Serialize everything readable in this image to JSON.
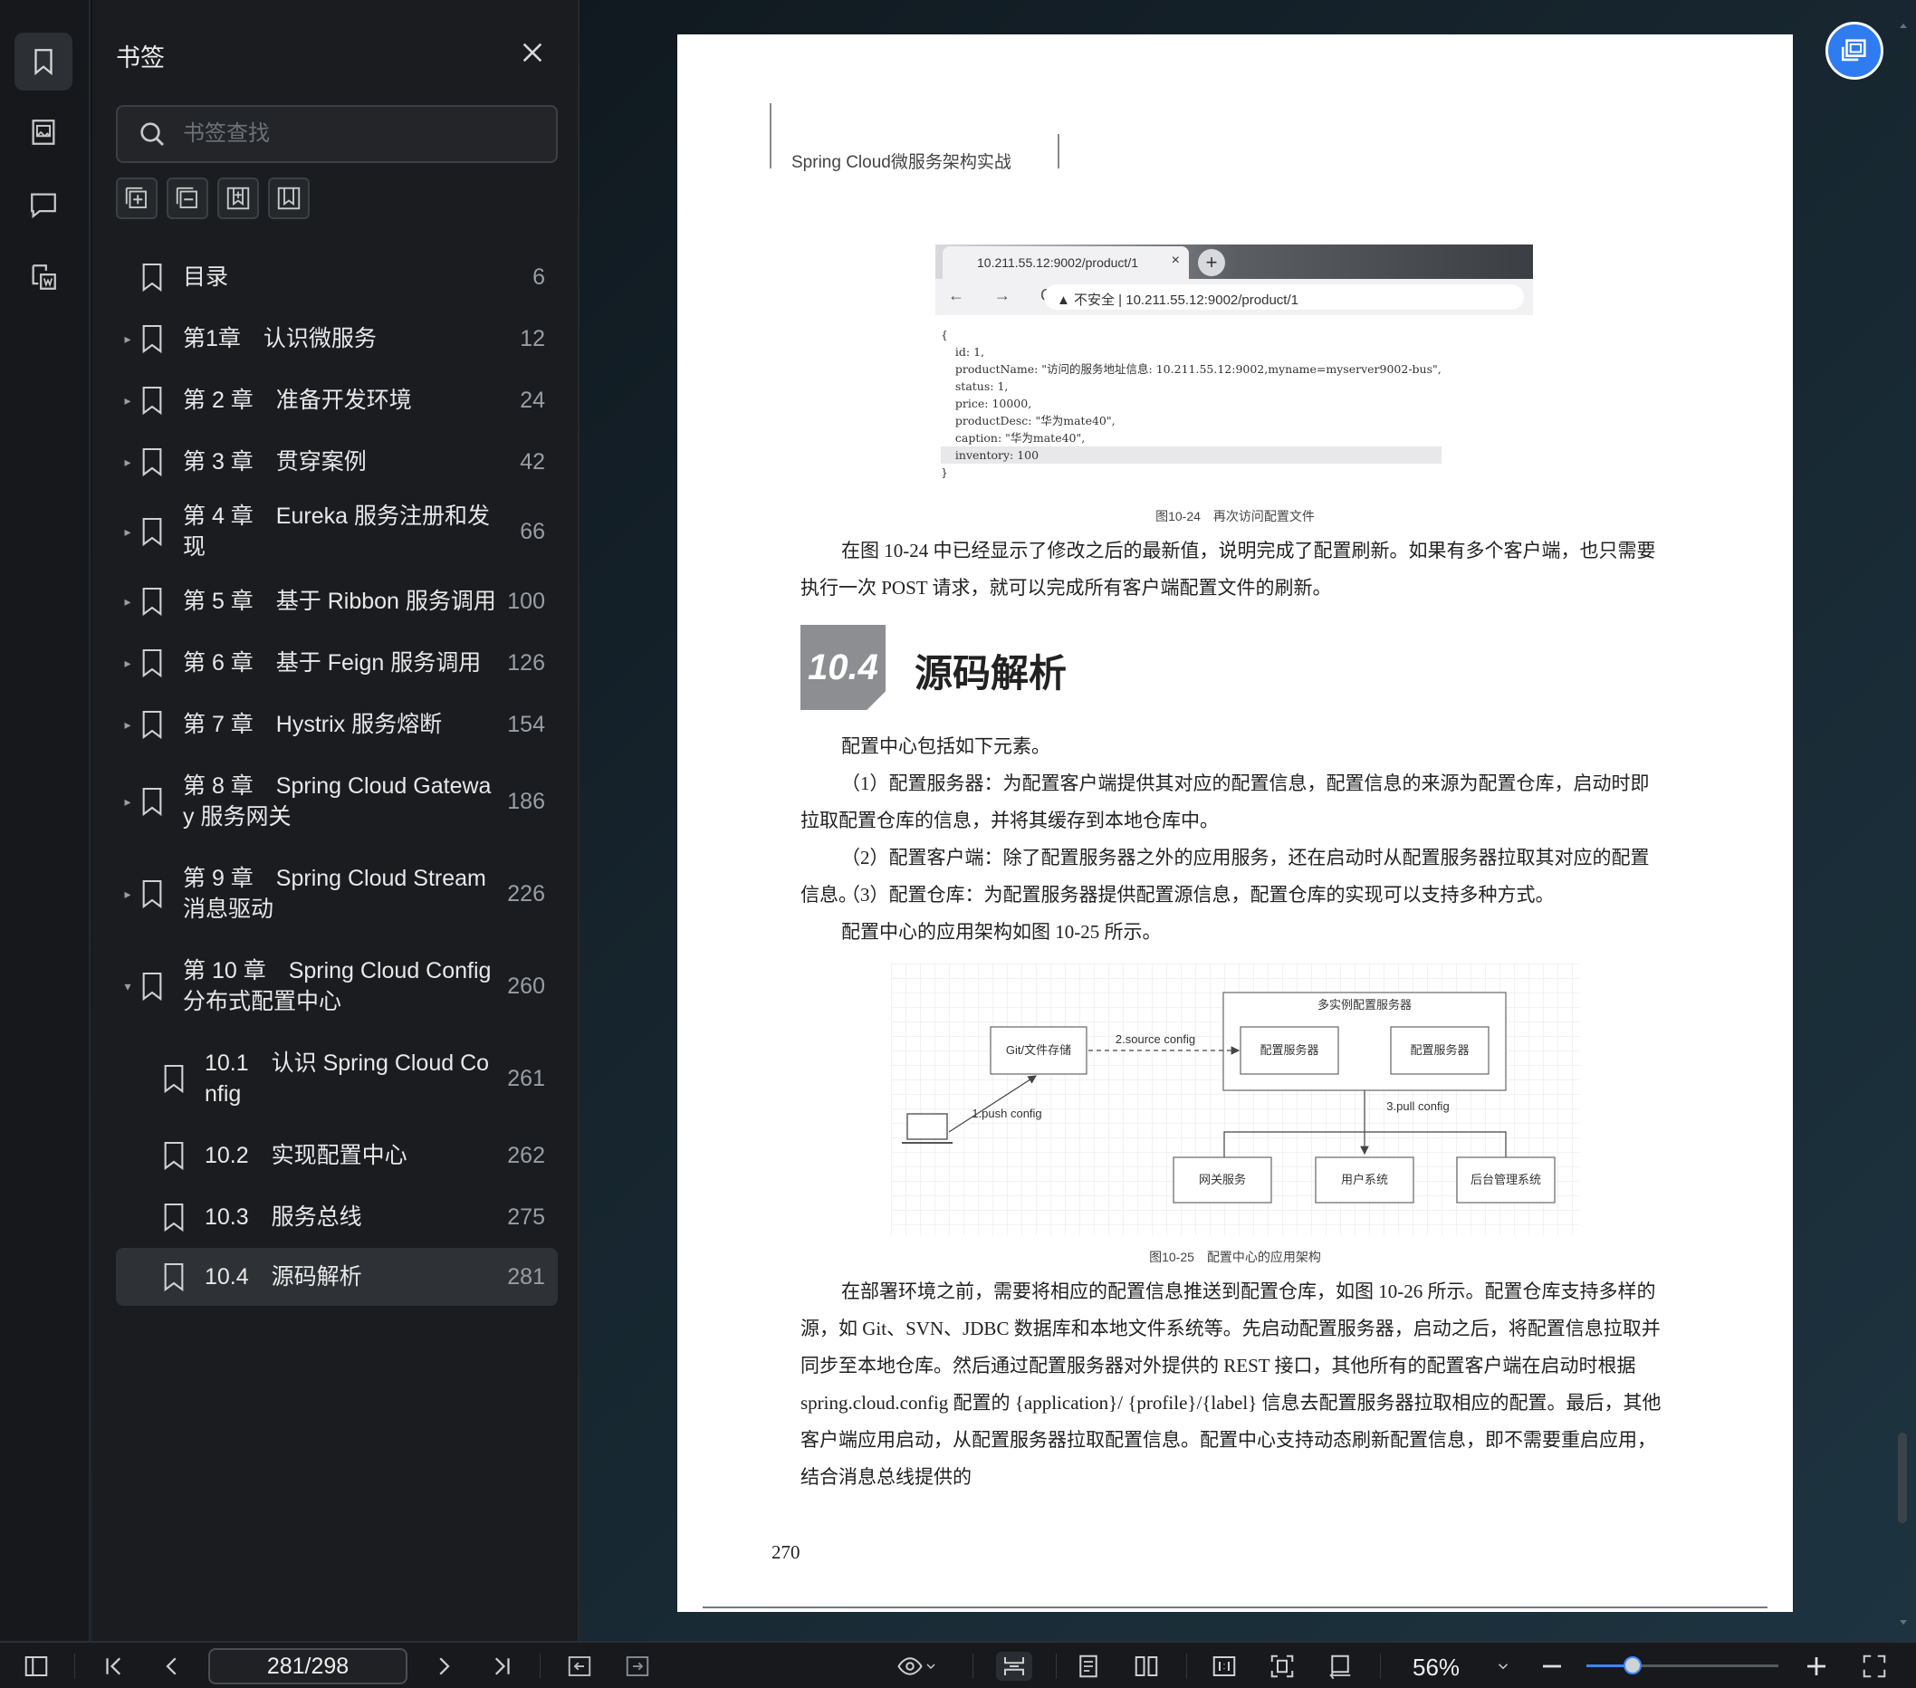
{
  "sidebar": {
    "title": "书签",
    "search_placeholder": "书签查找",
    "items": [
      {
        "label": "目录",
        "page": "6",
        "level": 0,
        "arrow": ""
      },
      {
        "label": "第1章　认识微服务",
        "page": "12",
        "level": 0,
        "arrow": "▸"
      },
      {
        "label": "第 2 章　准备开发环境",
        "page": "24",
        "level": 0,
        "arrow": "▸"
      },
      {
        "label": "第 3 章　贯穿案例",
        "page": "42",
        "level": 0,
        "arrow": "▸"
      },
      {
        "label": "第 4 章　Eureka 服务注册和发现",
        "page": "66",
        "level": 0,
        "arrow": "▸"
      },
      {
        "label": "第 5 章　基于 Ribbon 服务调用",
        "page": "100",
        "level": 0,
        "arrow": "▸"
      },
      {
        "label": "第 6 章　基于 Feign 服务调用",
        "page": "126",
        "level": 0,
        "arrow": "▸"
      },
      {
        "label": "第 7 章　Hystrix 服务熔断",
        "page": "154",
        "level": 0,
        "arrow": "▸"
      },
      {
        "label": "第 8 章　Spring Cloud Gateway 服务网关",
        "page": "186",
        "level": 0,
        "arrow": "▸"
      },
      {
        "label": "第 9 章　Spring Cloud Stream 消息驱动",
        "page": "226",
        "level": 0,
        "arrow": "▸"
      },
      {
        "label": "第 10 章　Spring Cloud Config 分布式配置中心",
        "page": "260",
        "level": 0,
        "arrow": "▾"
      },
      {
        "label": "10.1　认识 Spring Cloud Config",
        "page": "261",
        "level": 1,
        "arrow": ""
      },
      {
        "label": "10.2　实现配置中心",
        "page": "262",
        "level": 1,
        "arrow": ""
      },
      {
        "label": "10.3　服务总线",
        "page": "275",
        "level": 1,
        "arrow": ""
      },
      {
        "label": "10.4　源码解析",
        "page": "281",
        "level": 1,
        "arrow": "",
        "selected": true
      }
    ]
  },
  "document": {
    "header": "Spring Cloud微服务架构实战",
    "screenshot": {
      "tab_title": "10.211.55.12:9002/product/1",
      "tab_close": "×",
      "new_tab": "+",
      "nav": "← → C",
      "url": "▲ 不安全 | 10.211.55.12:9002/product/1",
      "json": [
        "{",
        "    id: 1,",
        "    productName: \"访问的服务地址信息: 10.211.55.12:9002,myname=myserver9002-bus\",",
        "    status: 1,",
        "    price: 10000,",
        "    productDesc: \"华为mate40\",",
        "    caption: \"华为mate40\",",
        "    inventory: 100",
        "}"
      ]
    },
    "fig1_caption": "图10-24　再次访问配置文件",
    "para1": "在图 10-24 中已经显示了修改之后的最新值，说明完成了配置刷新。如果有多个客户端，也只需要执行一次 POST 请求，就可以完成所有客户端配置文件的刷新。",
    "section_number": "10.4",
    "section_title": "源码解析",
    "para2": "配置中心包括如下元素。",
    "para3": "（1）配置服务器：为配置客户端提供其对应的配置信息，配置信息的来源为配置仓库，启动时即拉取配置仓库的信息，并将其缓存到本地仓库中。",
    "para4": "（2）配置客户端：除了配置服务器之外的应用服务，还在启动时从配置服务器拉取其对应的配置信息。",
    "para5": "（3）配置仓库：为配置服务器提供配置源信息，配置仓库的实现可以支持多种方式。",
    "para6": "配置中心的应用架构如图 10-25 所示。",
    "diagram": {
      "group_label": "多实例配置服务器",
      "git": "Git/文件存储",
      "server1": "配置服务器",
      "server2": "配置服务器",
      "edge_source": "2.source config",
      "edge_push": "1.push config",
      "edge_pull": "3.pull config",
      "client1": "网关服务",
      "client2": "用户系统",
      "client3": "后台管理系统"
    },
    "fig2_caption": "图10-25　配置中心的应用架构",
    "para7": "在部署环境之前，需要将相应的配置信息推送到配置仓库，如图 10-26 所示。配置仓库支持多样的源，如 Git、SVN、JDBC 数据库和本地文件系统等。先启动配置服务器，启动之后，将配置信息拉取并同步至本地仓库。然后通过配置服务器对外提供的 REST 接口，其他所有的配置客户端在启动时根据 spring.cloud.config 配置的 {application}/ {profile}/{label} 信息去配置服务器拉取相应的配置。最后，其他客户端应用启动，从配置服务器拉取配置信息。配置中心支持动态刷新配置信息，即不需要重启应用，结合消息总线提供的",
    "page_number": "270"
  },
  "toolbar": {
    "page_indicator": "281/298",
    "zoom": "56%",
    "zoom_level": 0.56
  },
  "colors": {
    "accent": "#3b86ff",
    "panel_bg": "#1a1c1f",
    "selected_row": "#2e3135"
  }
}
